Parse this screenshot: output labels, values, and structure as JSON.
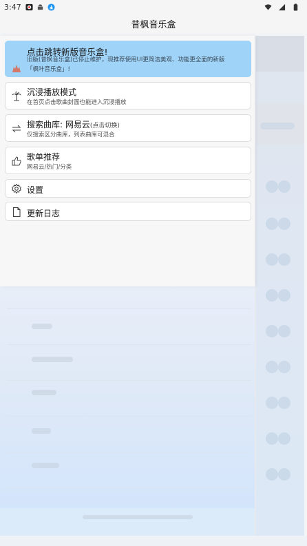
{
  "status_bar": {
    "time": "3:47",
    "icons": [
      "app-badge-icon",
      "android-icon",
      "download-icon",
      "wifi-icon",
      "signal-icon",
      "battery-icon"
    ]
  },
  "header": {
    "title": "昔枫音乐盒"
  },
  "drawer": {
    "banner": {
      "title": "点击跳转新版音乐盒!",
      "desc_line1": "旧版(昔枫音乐盒)已停止维护，现推荐使用UI更简洁美观、功能更全面的新版",
      "desc_line2": "「枫叶音乐盒」!",
      "icon": "maple-leaf-icon"
    },
    "items": [
      {
        "title": "沉浸播放模式",
        "subtitle": "在首页点击歌曲封面也能进入沉浸播放",
        "icon": "palm-tree-icon"
      },
      {
        "title": "搜索曲库: 网易云",
        "title_suffix": "(点击切换)",
        "subtitle": "仅搜索区分曲库，列表曲库可混合",
        "icon": "swap-arrows-icon"
      },
      {
        "title": "歌单推荐",
        "subtitle": "网易云/热门/分类",
        "icon": "thumbs-up-icon"
      },
      {
        "title": "设置",
        "icon": "gear-icon"
      },
      {
        "title": "更新日志",
        "icon": "document-icon"
      }
    ]
  },
  "colors": {
    "banner_bg": "#9fd3f7",
    "card_bg": "#ffffff",
    "card_border": "#dcdcdc",
    "page_bg": "#f3f4f6"
  }
}
